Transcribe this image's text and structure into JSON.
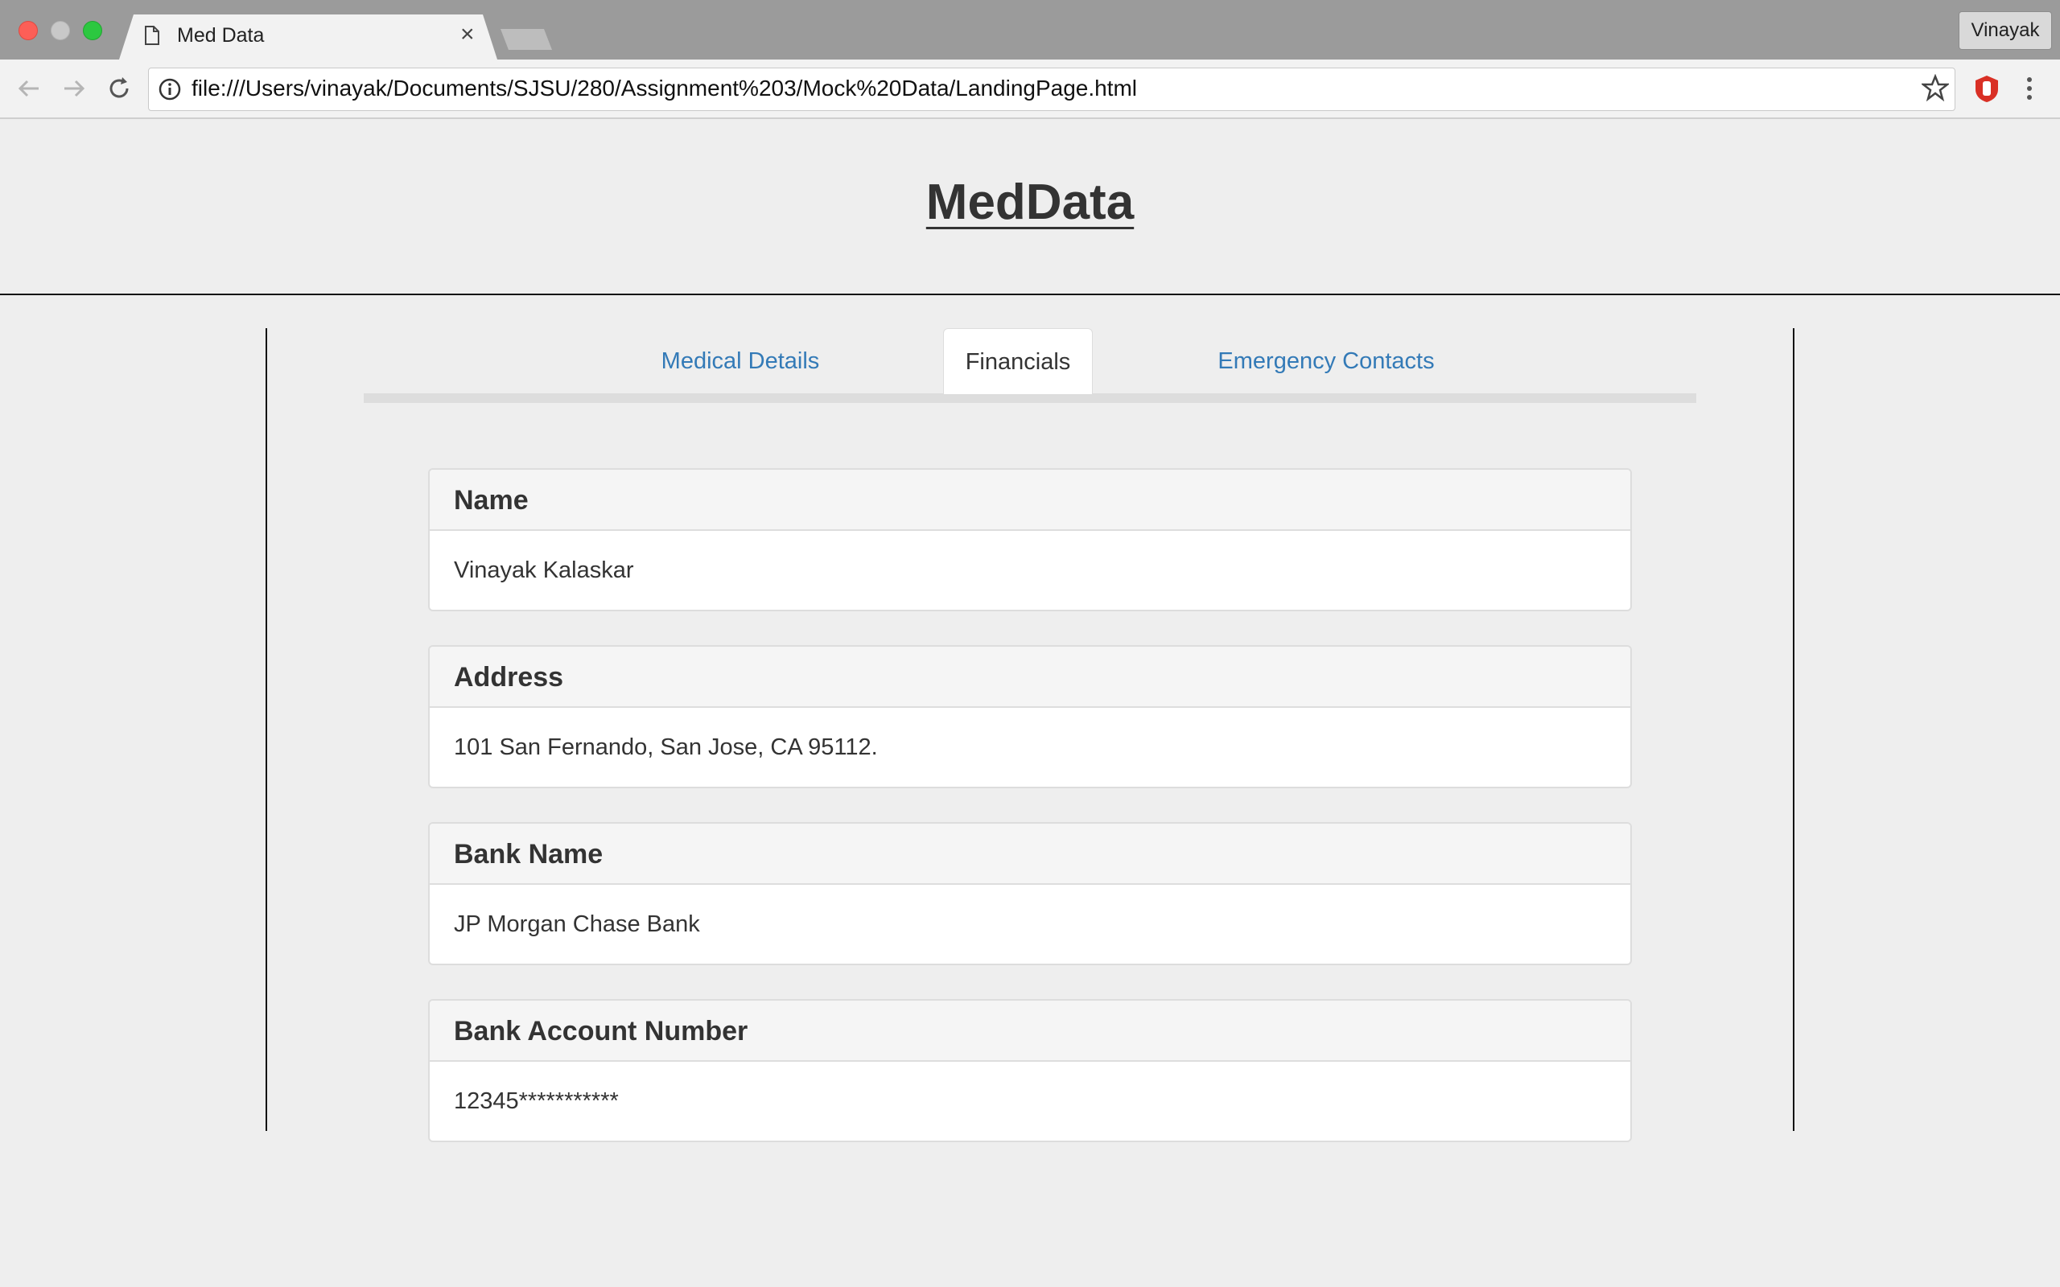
{
  "browser": {
    "tab_title": "Med Data",
    "tab_close": "×",
    "profile_name": "Vinayak",
    "url": "file:///Users/vinayak/Documents/SJSU/280/Assignment%203/Mock%20Data/LandingPage.html"
  },
  "page": {
    "title": "MedData",
    "tabs": [
      {
        "label": "Medical Details",
        "active": false
      },
      {
        "label": "Financials",
        "active": true
      },
      {
        "label": "Emergency Contacts",
        "active": false
      }
    ],
    "panels": [
      {
        "heading": "Name",
        "value": "Vinayak Kalaskar"
      },
      {
        "heading": "Address",
        "value": "101 San Fernando, San Jose, CA 95112."
      },
      {
        "heading": "Bank Name",
        "value": "JP Morgan Chase Bank"
      },
      {
        "heading": "Bank Account Number",
        "value": "12345***********"
      }
    ]
  },
  "colors": {
    "link": "#337ab7",
    "page_bg": "#eeeeee",
    "panel_heading_bg": "#f5f5f5"
  },
  "icons": [
    "page-icon",
    "back-arrow-icon",
    "forward-arrow-icon",
    "reload-icon",
    "info-icon",
    "star-icon",
    "extension-icon",
    "kebab-menu-icon"
  ]
}
